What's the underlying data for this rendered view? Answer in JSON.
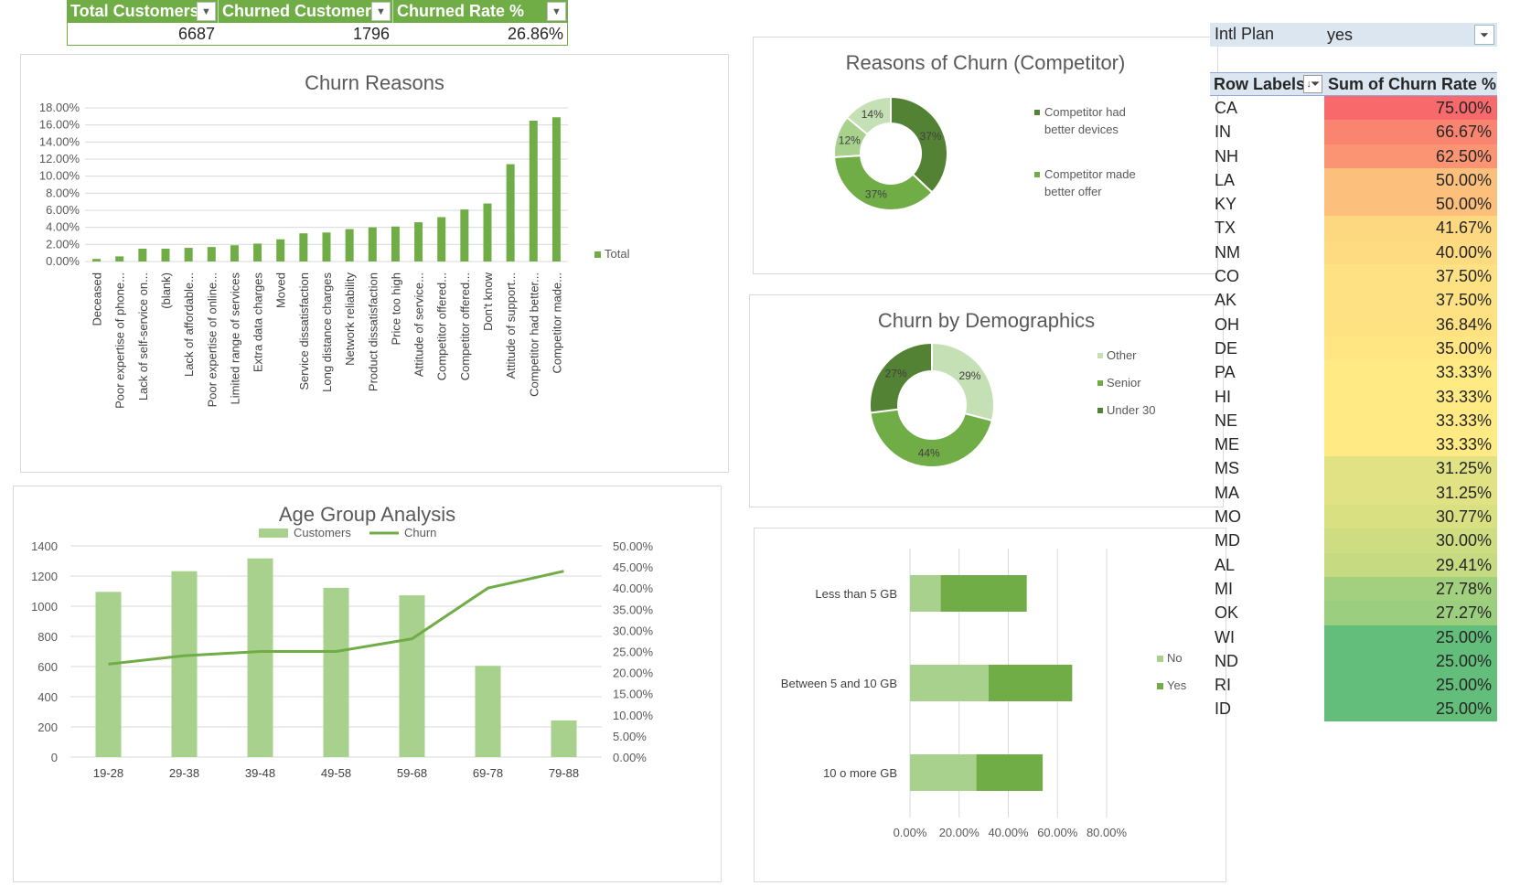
{
  "kpi": {
    "headers": [
      "Total Customers",
      "Churned Customers",
      "Churned Rate %"
    ],
    "values": [
      "6687",
      "1796",
      "26.86%"
    ]
  },
  "colors": {
    "green": "#70ad47",
    "dark_green": "#548235",
    "light_green": "#a9d18e",
    "pale_green": "#c5e0b4",
    "header_fill": "#dce6f1"
  },
  "chart_data": [
    {
      "type": "bar",
      "title": "Churn Reasons",
      "categories": [
        "Deceased",
        "Poor expertise of phone...",
        "Lack of self-service on...",
        "(blank)",
        "Lack of affordable...",
        "Poor expertise of online...",
        "Limited range of services",
        "Extra data charges",
        "Moved",
        "Service dissatisfaction",
        "Long distance charges",
        "Network reliability",
        "Product dissatisfaction",
        "Price too high",
        "Attitude of service...",
        "Competitor offered...",
        "Competitor offered...",
        "Don't know",
        "Attitude of support...",
        "Competitor had better...",
        "Competitor made..."
      ],
      "series": [
        {
          "name": "Total",
          "values": [
            0.3,
            0.6,
            1.5,
            1.5,
            1.6,
            1.7,
            1.9,
            2.1,
            2.6,
            3.3,
            3.4,
            3.8,
            4.0,
            4.1,
            4.6,
            5.2,
            6.1,
            6.8,
            11.4,
            16.5,
            16.9
          ]
        }
      ],
      "ylim": [
        0,
        18
      ],
      "yticks": [
        "0.00%",
        "2.00%",
        "4.00%",
        "6.00%",
        "8.00%",
        "10.00%",
        "12.00%",
        "14.00%",
        "16.00%",
        "18.00%"
      ],
      "legend": "right",
      "legend_label": "Total"
    },
    {
      "type": "pie",
      "title": "Reasons of Churn (Competitor)",
      "slices": [
        {
          "label": "37%",
          "value": 37,
          "color": "#548235"
        },
        {
          "label": "37%",
          "value": 37,
          "color": "#70ad47"
        },
        {
          "label": "12%",
          "value": 12,
          "color": "#a9d18e"
        },
        {
          "label": "14%",
          "value": 14,
          "color": "#c5e0b4"
        }
      ],
      "legend": [
        {
          "label": "Competitor had better devices",
          "color": "#548235"
        },
        {
          "label": "Competitor made better offer",
          "color": "#70ad47"
        }
      ],
      "legend_lines": [
        [
          "Competitor had",
          "better devices"
        ],
        [
          "Competitor made",
          "better offer"
        ]
      ]
    },
    {
      "type": "pie",
      "title": "Churn by Demographics",
      "slices": [
        {
          "label": "29%",
          "value": 29,
          "color": "#c5e0b4"
        },
        {
          "label": "44%",
          "value": 44,
          "color": "#70ad47"
        },
        {
          "label": "27%",
          "value": 27,
          "color": "#548235"
        }
      ],
      "legend": [
        {
          "label": "Other",
          "color": "#c5e0b4"
        },
        {
          "label": "Senior",
          "color": "#70ad47"
        },
        {
          "label": "Under 30",
          "color": "#548235"
        }
      ]
    },
    {
      "type": "bar",
      "title": "Age Group Analysis",
      "categories": [
        "19-28",
        "29-38",
        "39-48",
        "49-58",
        "59-68",
        "69-78",
        "79-88"
      ],
      "series": [
        {
          "name": "Customers",
          "axis": "left",
          "kind": "bar",
          "values": [
            1095,
            1232,
            1317,
            1122,
            1072,
            605,
            243
          ]
        },
        {
          "name": "Churn",
          "axis": "right",
          "kind": "line",
          "values": [
            22,
            24,
            25,
            25,
            28,
            40,
            44
          ]
        }
      ],
      "ylim": [
        0,
        1400
      ],
      "y2lim": [
        0,
        50
      ],
      "yticks": [
        "0",
        "200",
        "400",
        "600",
        "800",
        "1000",
        "1200",
        "1400"
      ],
      "y2ticks": [
        "0.00%",
        "5.00%",
        "10.00%",
        "15.00%",
        "20.00%",
        "25.00%",
        "30.00%",
        "35.00%",
        "40.00%",
        "45.00%",
        "50.00%"
      ],
      "legend": "top"
    },
    {
      "type": "bar",
      "title": "",
      "orientation": "horizontal",
      "stacked": true,
      "categories": [
        "Less than 5 GB",
        "Between 5 and 10 GB",
        "10 o more GB"
      ],
      "series": [
        {
          "name": "No",
          "values": [
            12.5,
            32,
            27
          ]
        },
        {
          "name": "Yes",
          "values": [
            35,
            34,
            27
          ]
        }
      ],
      "xlim": [
        0,
        80
      ],
      "xticks": [
        "0.00%",
        "20.00%",
        "40.00%",
        "60.00%",
        "80.00%"
      ],
      "legend": "right"
    }
  ],
  "slicer": {
    "label": "Intl Plan",
    "value": "yes"
  },
  "pivot": {
    "header_rows": "Row Labels",
    "header_value": "Sum of Churn Rate %",
    "rows": [
      {
        "state": "CA",
        "rate": "75.00%",
        "color": "#f8696b"
      },
      {
        "state": "IN",
        "rate": "66.67%",
        "color": "#f98570"
      },
      {
        "state": "NH",
        "rate": "62.50%",
        "color": "#fa9473"
      },
      {
        "state": "LA",
        "rate": "50.00%",
        "color": "#fcc07c"
      },
      {
        "state": "KY",
        "rate": "50.00%",
        "color": "#fcc07c"
      },
      {
        "state": "TX",
        "rate": "41.67%",
        "color": "#fdd880"
      },
      {
        "state": "NM",
        "rate": "40.00%",
        "color": "#fedb81"
      },
      {
        "state": "CO",
        "rate": "37.50%",
        "color": "#fee182"
      },
      {
        "state": "AK",
        "rate": "37.50%",
        "color": "#fee182"
      },
      {
        "state": "OH",
        "rate": "36.84%",
        "color": "#fee282"
      },
      {
        "state": "DE",
        "rate": "35.00%",
        "color": "#ffe683"
      },
      {
        "state": "PA",
        "rate": "33.33%",
        "color": "#ffea84"
      },
      {
        "state": "HI",
        "rate": "33.33%",
        "color": "#ffea84"
      },
      {
        "state": "NE",
        "rate": "33.33%",
        "color": "#ffea84"
      },
      {
        "state": "ME",
        "rate": "33.33%",
        "color": "#ffea84"
      },
      {
        "state": "MS",
        "rate": "31.25%",
        "color": "#e0e283"
      },
      {
        "state": "MA",
        "rate": "31.25%",
        "color": "#e0e283"
      },
      {
        "state": "MO",
        "rate": "30.77%",
        "color": "#d9e082"
      },
      {
        "state": "MD",
        "rate": "30.00%",
        "color": "#cedd82"
      },
      {
        "state": "AL",
        "rate": "29.41%",
        "color": "#c6db81"
      },
      {
        "state": "MI",
        "rate": "27.78%",
        "color": "#a2d07f"
      },
      {
        "state": "OK",
        "rate": "27.27%",
        "color": "#9bce7e"
      },
      {
        "state": "WI",
        "rate": "25.00%",
        "color": "#63be7b"
      },
      {
        "state": "ND",
        "rate": "25.00%",
        "color": "#63be7b"
      },
      {
        "state": "RI",
        "rate": "25.00%",
        "color": "#63be7b"
      },
      {
        "state": "ID",
        "rate": "25.00%",
        "color": "#63be7b"
      }
    ]
  }
}
